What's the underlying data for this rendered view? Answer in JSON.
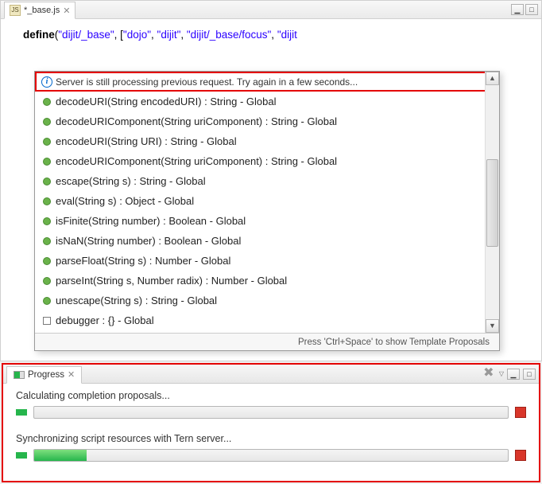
{
  "editor": {
    "tab_label": "*_base.js",
    "code_kw": "define",
    "code_paren_open": "(",
    "code_str1": "\"dijit/_base\"",
    "code_sep1": ", [",
    "code_str2": "\"dojo\"",
    "code_sep2": ", ",
    "code_str3": "\"dijit\"",
    "code_sep3": ", ",
    "code_str4": "\"dijit/_base/focus\"",
    "code_sep4": ", ",
    "code_str5": "\"dijit"
  },
  "popup": {
    "message": "Server is still processing previous request. Try again in a few seconds...",
    "items": [
      "decodeURI(String encodedURI) : String - Global",
      "decodeURIComponent(String uriComponent) : String - Global",
      "encodeURI(String URI) : String - Global",
      "encodeURIComponent(String uriComponent) : String - Global",
      "escape(String s) : String - Global",
      "eval(String s) : Object - Global",
      "isFinite(String number) : Boolean - Global",
      "isNaN(String number) : Boolean - Global",
      "parseFloat(String s) : Number - Global",
      "parseInt(String s, Number radix) : Number - Global",
      "unescape(String s) : String - Global",
      "debugger : {} - Global"
    ],
    "footer": "Press 'Ctrl+Space' to show Template Proposals"
  },
  "progress": {
    "tab_label": "Progress",
    "item1_label": "Calculating completion proposals...",
    "item1_pct": 0,
    "item2_label": "Synchronizing script resources with Tern server...",
    "item2_pct": 11
  }
}
